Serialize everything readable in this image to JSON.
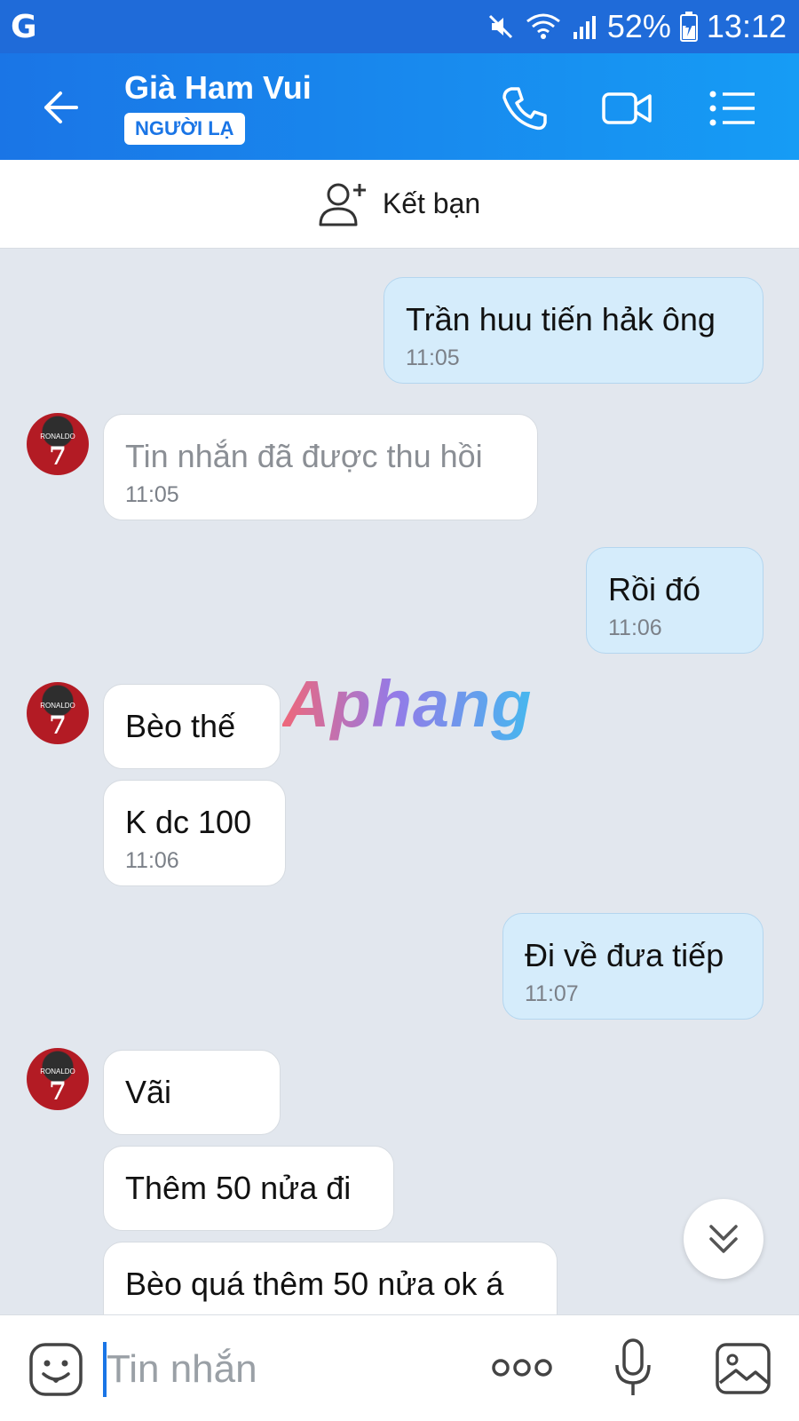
{
  "status_bar": {
    "app_icon": "G",
    "battery": "52%",
    "time": "13:12"
  },
  "header": {
    "title": "Già Ham Vui",
    "badge": "NGƯỜI LẠ"
  },
  "friend_bar": {
    "label": "Kết bạn"
  },
  "watermark": "Aphang",
  "messages": [
    {
      "side": "out",
      "text": "Trần huu tiến hảk ông",
      "time": "11:05"
    },
    {
      "side": "in",
      "text": "Tin nhắn đã được thu hồi",
      "time": "11:05",
      "recalled": true
    },
    {
      "side": "out",
      "text": "Rồi đó",
      "time": "11:06"
    },
    {
      "side": "in",
      "text": "Bèo thế",
      "time": ""
    },
    {
      "side": "in",
      "text": "K dc 100",
      "time": "11:06"
    },
    {
      "side": "out",
      "text": "Đi về đưa tiếp",
      "time": "11:07"
    },
    {
      "side": "in",
      "text": "Vãi",
      "time": ""
    },
    {
      "side": "in",
      "text": "Thêm 50 nửa đi",
      "time": ""
    },
    {
      "side": "in",
      "text": "Bèo quá thêm 50 nửa ok á",
      "time": ""
    }
  ],
  "avatar_jersey": {
    "name": "RONALDO",
    "number": "7"
  },
  "input": {
    "placeholder": "Tin nhắn"
  },
  "colors": {
    "header_start": "#1a75e6",
    "header_end": "#169cf5",
    "out_bubble": "#d5ecfb",
    "in_bubble": "#ffffff",
    "chat_bg": "#e2e7ee"
  }
}
